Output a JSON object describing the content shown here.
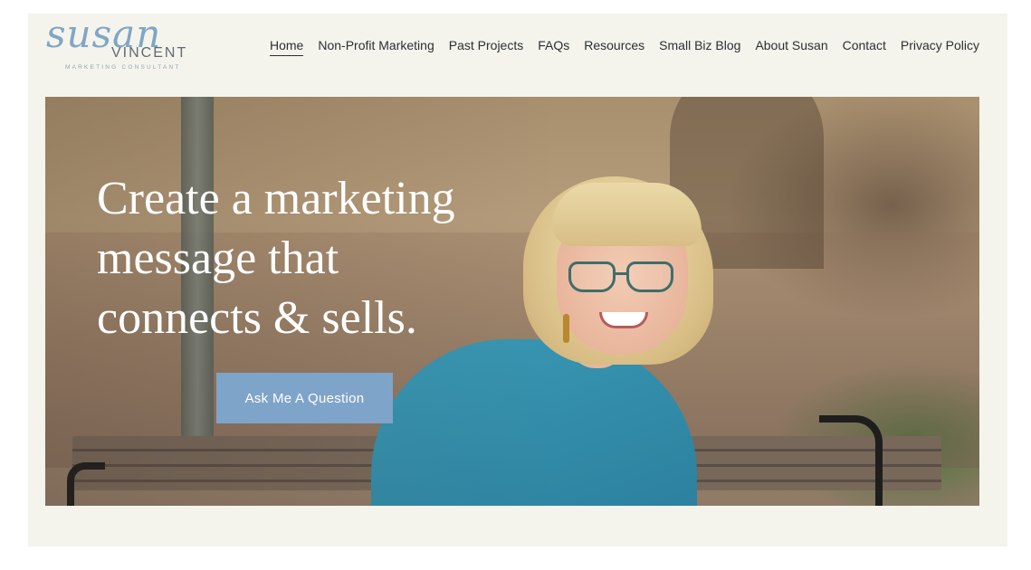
{
  "logo": {
    "script_text": "susan",
    "name": "VINCENT",
    "tagline": "MARKETING CONSULTANT"
  },
  "nav": {
    "items": [
      {
        "label": "Home",
        "active": true
      },
      {
        "label": "Non-Profit Marketing",
        "active": false
      },
      {
        "label": "Past Projects",
        "active": false
      },
      {
        "label": "FAQs",
        "active": false
      },
      {
        "label": "Resources",
        "active": false
      },
      {
        "label": "Small Biz Blog",
        "active": false
      },
      {
        "label": "About Susan",
        "active": false
      },
      {
        "label": "Contact",
        "active": false
      },
      {
        "label": "Privacy Policy",
        "active": false
      }
    ]
  },
  "hero": {
    "headline_line1": "Create a marketing",
    "headline_line2": "message that",
    "headline_line3": "connects & sells.",
    "cta_label": "Ask Me A Question"
  },
  "colors": {
    "page_background": "#f5f4ec",
    "accent": "#7fa4c9",
    "logo_blue": "#7fa6c6",
    "text": "#2a2f33"
  }
}
